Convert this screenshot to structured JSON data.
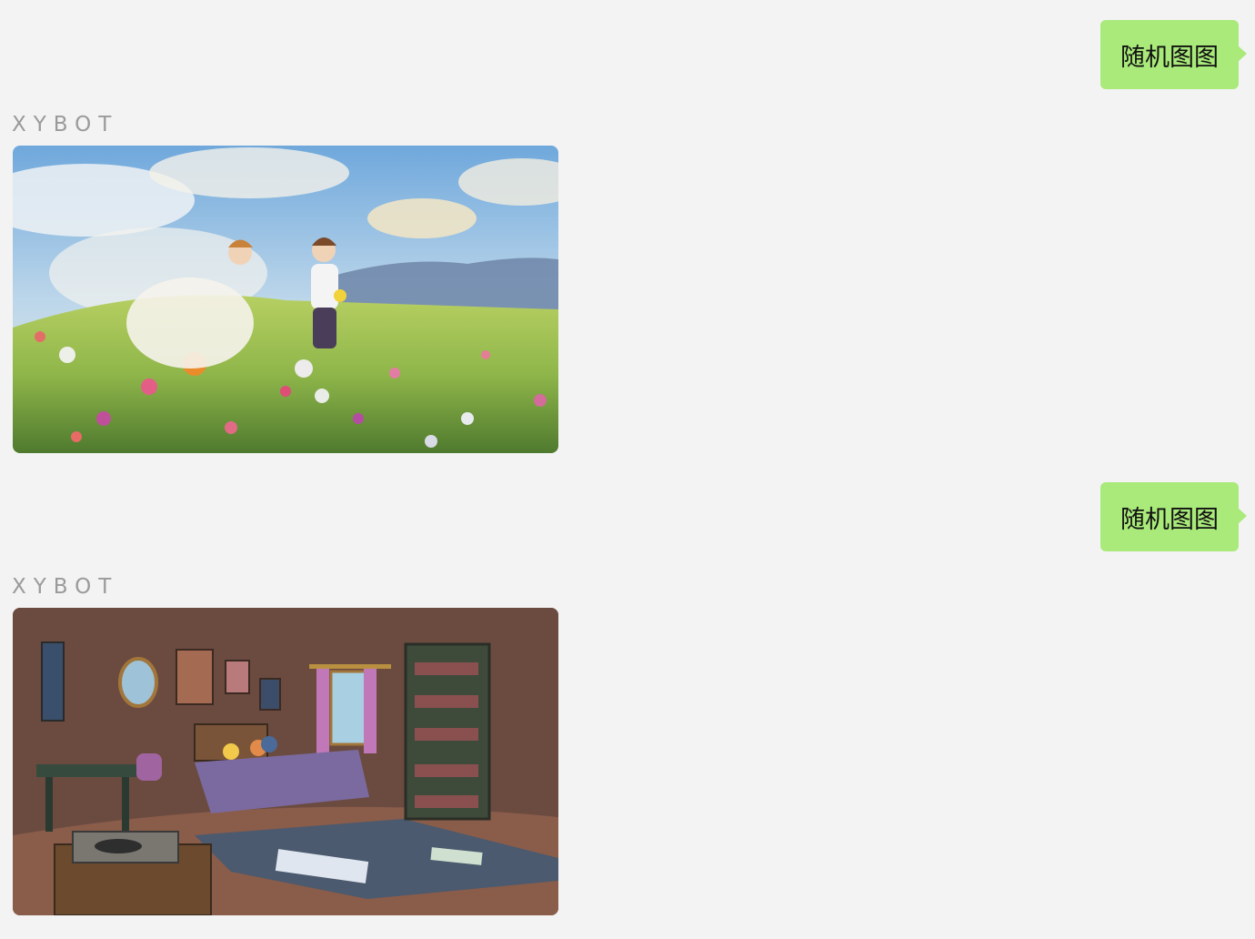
{
  "messages": [
    {
      "type": "outgoing-text",
      "text": "随机图图"
    },
    {
      "type": "incoming-image",
      "sender": "XYBOT",
      "image": "anime-meadow-couple-illustration"
    },
    {
      "type": "outgoing-text",
      "text": "随机图图"
    },
    {
      "type": "incoming-image",
      "sender": "XYBOT",
      "image": "cozy-cartoon-bedroom-illustration"
    }
  ],
  "colors": {
    "background": "#f3f3f3",
    "outgoing_bubble": "#a9ea7a",
    "sender_name": "#9a9a9a"
  }
}
